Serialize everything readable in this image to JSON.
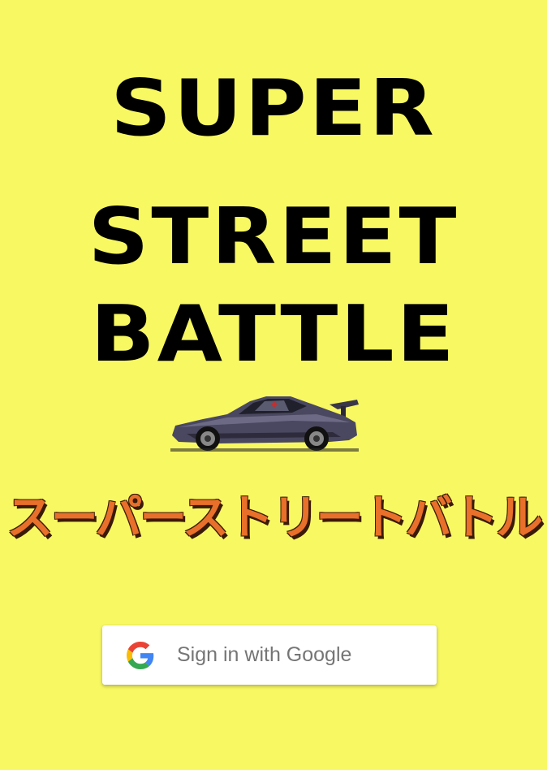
{
  "title": {
    "line1": "SUPER",
    "line2": "STREET",
    "line3": "BATTLE"
  },
  "japanese_title": "スーパーストリートバトル",
  "signin": {
    "label": "Sign in with Google",
    "icon": "google-g-icon"
  },
  "colors": {
    "background": "#f8f862",
    "title": "#000000",
    "japanese_title": "#e8702a",
    "button_bg": "#ffffff",
    "button_text": "#757575"
  },
  "car": {
    "icon": "sports-car-sprite"
  }
}
